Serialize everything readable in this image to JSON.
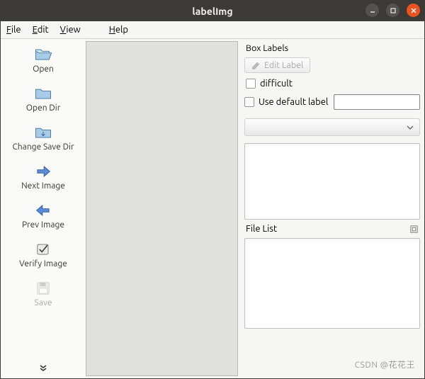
{
  "window": {
    "title": "labelImg"
  },
  "menu": {
    "file": "File",
    "edit": "Edit",
    "view": "View",
    "help": "Help"
  },
  "toolbar": {
    "open": "Open",
    "open_dir": "Open Dir",
    "change_save_dir": "Change Save Dir",
    "next_image": "Next Image",
    "prev_image": "Prev Image",
    "verify_image": "Verify Image",
    "save": "Save"
  },
  "right": {
    "box_labels_title": "Box Labels",
    "edit_label": "Edit Label",
    "difficult": "difficult",
    "use_default_label": "Use default label",
    "default_label_value": "",
    "dropdown_value": "",
    "file_list_title": "File List"
  },
  "watermark": "CSDN @花花王"
}
